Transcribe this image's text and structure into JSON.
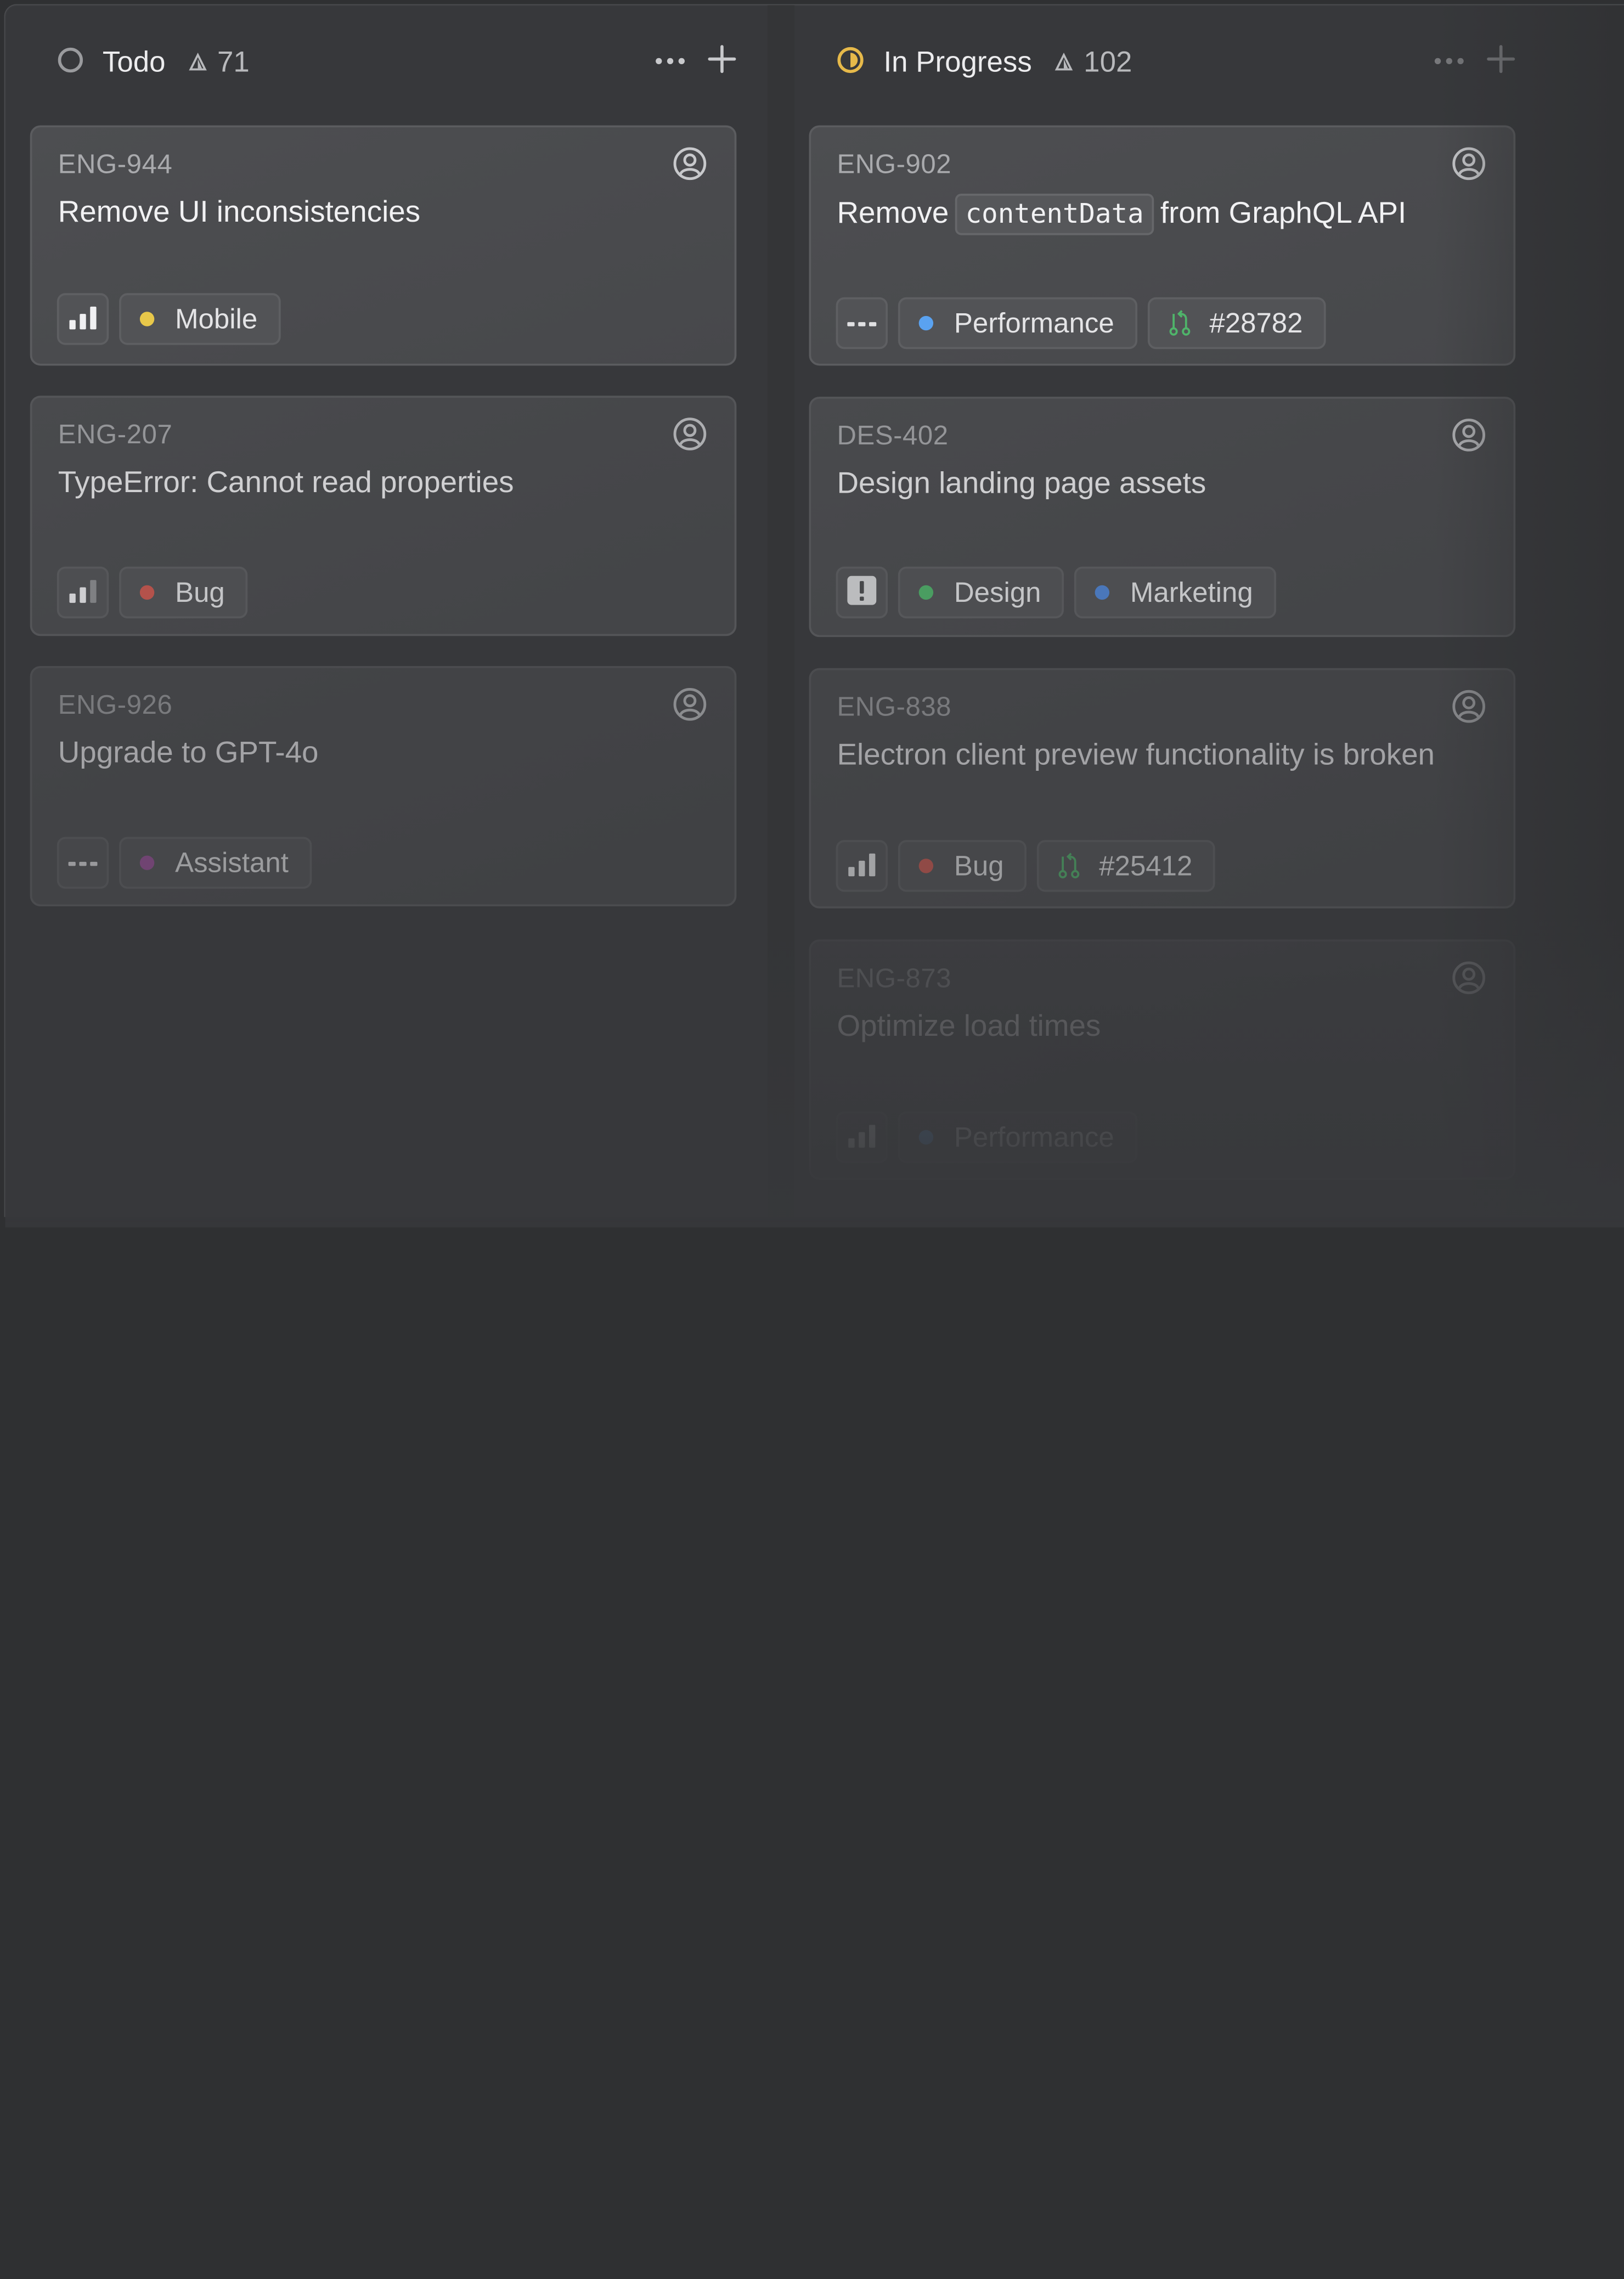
{
  "columns": [
    {
      "title": "Todo",
      "count": "71",
      "cards": [
        {
          "id": "ENG-944",
          "title": "Remove UI inconsistencies",
          "labels": [
            {
              "text": "Mobile",
              "color": "#e8c84a"
            }
          ]
        },
        {
          "id": "ENG-207",
          "title": "TypeError: Cannot read properties",
          "labels": [
            {
              "text": "Bug",
              "color": "#d0584f"
            }
          ]
        },
        {
          "id": "ENG-926",
          "title": "Upgrade to GPT-4o",
          "labels": [
            {
              "text": "Assistant",
              "color": "#9a4d9a"
            }
          ]
        }
      ]
    },
    {
      "title": "In Progress",
      "count": "102",
      "cards": [
        {
          "id": "ENG-902",
          "title_parts": {
            "before": "Remove",
            "code": "contentData",
            "after": "from GraphQL API"
          },
          "labels": [
            {
              "text": "Performance",
              "color": "#5aa2f0"
            }
          ],
          "pr": "#28782"
        },
        {
          "id": "DES-402",
          "title": "Design landing page assets",
          "labels": [
            {
              "text": "Design",
              "color": "#4fb46a"
            },
            {
              "text": "Marketing",
              "color": "#4f86d6"
            }
          ]
        },
        {
          "id": "ENG-838",
          "title": "Electron client preview functionality is broken",
          "labels": [
            {
              "text": "Bug",
              "color": "#d0584f"
            }
          ],
          "pr": "#25412"
        },
        {
          "id": "ENG-873",
          "title": "Optimize load times",
          "labels": [
            {
              "text": "Performance",
              "color": "#5aa2f0"
            }
          ]
        }
      ]
    }
  ],
  "icons": {
    "todo_status": "circle-outline-icon",
    "in_progress_status": "half-circle-icon",
    "count": "triangle-icon",
    "more": "ellipsis-icon",
    "add": "plus-icon",
    "assignee": "user-avatar-icon",
    "priority_high": "signal-bars-icon",
    "priority_none": "no-priority-icon",
    "priority_urgent": "urgent-icon",
    "pull_request": "pull-request-icon"
  },
  "colors": {
    "in_progress": "#e6b94a",
    "todo_ring": "#9a9b9e",
    "pr_icon": "#4fb46a"
  }
}
